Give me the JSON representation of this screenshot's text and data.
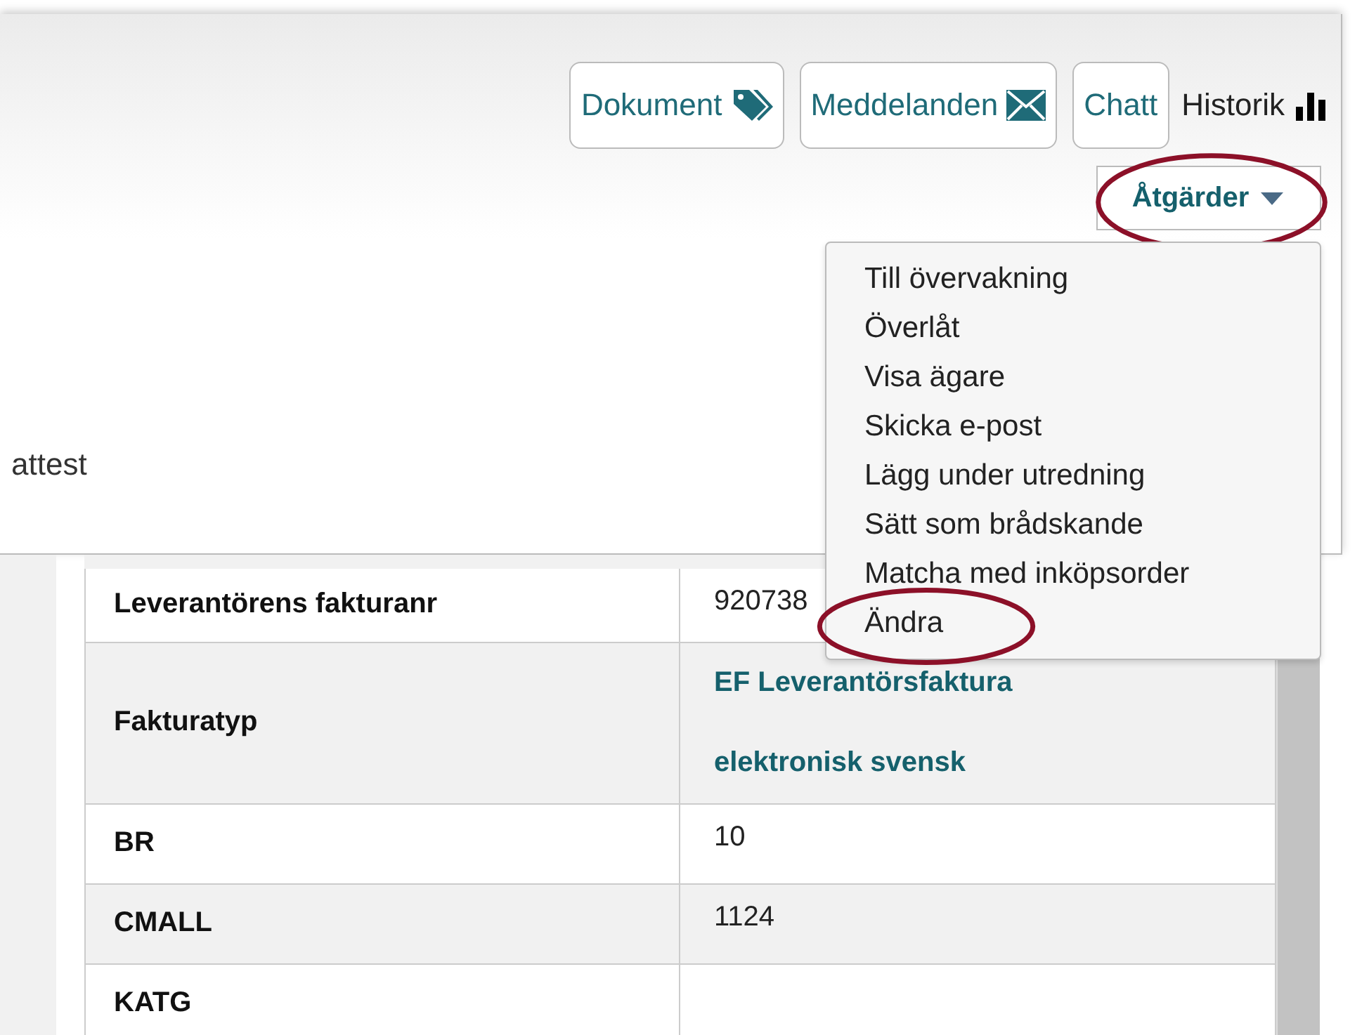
{
  "toolbar": {
    "buttons": [
      {
        "label": "Dokument",
        "kind": "tags"
      },
      {
        "label": "Meddelanden",
        "kind": "mail"
      },
      {
        "label": "Chatt",
        "kind": "none"
      }
    ],
    "history": {
      "label": "Historik"
    }
  },
  "actions": {
    "label": "Åtgärder",
    "expanded": true,
    "circled": true,
    "menu": [
      {
        "label": "Till övervakning",
        "circled": false
      },
      {
        "label": "Överlåt",
        "circled": false
      },
      {
        "label": "Visa ägare",
        "circled": false
      },
      {
        "label": "Skicka e-post",
        "circled": false
      },
      {
        "label": "Lägg under utredning",
        "circled": false
      },
      {
        "label": "Sätt som brådskande",
        "circled": false
      },
      {
        "label": "Matcha med inköpsorder",
        "circled": false
      },
      {
        "label": "Ändra",
        "circled": true
      }
    ]
  },
  "panel_text": "attest",
  "table": {
    "rows": [
      {
        "label": "Leverantörens fakturanr",
        "value": "920738",
        "kind": "plain"
      },
      {
        "label": "Fakturatyp",
        "value": "EF Leverantörsfaktura elektronisk svensk",
        "kind": "link"
      },
      {
        "label": "BR",
        "value": "10",
        "kind": "plain"
      },
      {
        "label": "CMALL",
        "value": "1124",
        "kind": "plain"
      },
      {
        "label": "KATG",
        "value": "",
        "kind": "plain"
      }
    ]
  }
}
